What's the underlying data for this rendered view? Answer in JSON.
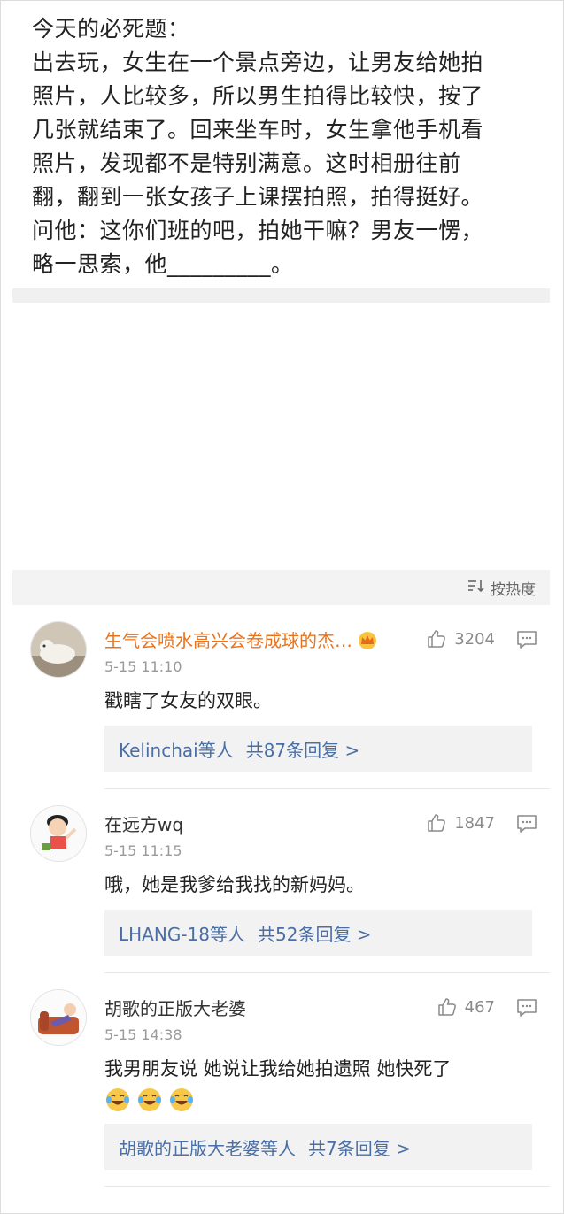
{
  "post": {
    "lines": [
      "今天的必死题：",
      "出去玩，女生在一个景点旁边，让男友给她拍",
      "照片，人比较多，所以男生拍得比较快，按了",
      "几张就结束了。回来坐车时，女生拿他手机看",
      "照片，发现都不是特别满意。这时相册往前",
      "翻，翻到一张女孩子上课摆拍照，拍得挺好。",
      "问他：这你们班的吧，拍她干嘛？男友一愣，",
      "略一思索，他_________。"
    ]
  },
  "sort": {
    "label": "按热度",
    "icon": "sort-icon"
  },
  "comments": [
    {
      "username": "生气会喷水高兴会卷成球的杰…",
      "badge": "crown-icon",
      "likes": "3204",
      "time": "5-15 11:10",
      "text": "戳瞎了女友的双眼。",
      "replies": {
        "users": "Kelinchai等人",
        "count": "共87条回复 >"
      }
    },
    {
      "username": "在远方wq",
      "likes": "1847",
      "time": "5-15 11:15",
      "text": "哦，她是我爹给我找的新妈妈。",
      "replies": {
        "users": "LHANG-18等人",
        "count": "共52条回复 >"
      }
    },
    {
      "username": "胡歌的正版大老婆",
      "likes": "467",
      "time": "5-15 14:38",
      "text": "我男朋友说 她说让我给她拍遗照 她快死了",
      "emojis": [
        "laugh-cry-emoji",
        "laugh-cry-emoji",
        "laugh-cry-emoji"
      ],
      "replies": {
        "users": "胡歌的正版大老婆等人",
        "count": "共7条回复 >"
      }
    }
  ],
  "colors": {
    "vip_name": "#e8731c",
    "reply_link": "#4a6fa5",
    "meta_gray": "#9a9a9a"
  }
}
